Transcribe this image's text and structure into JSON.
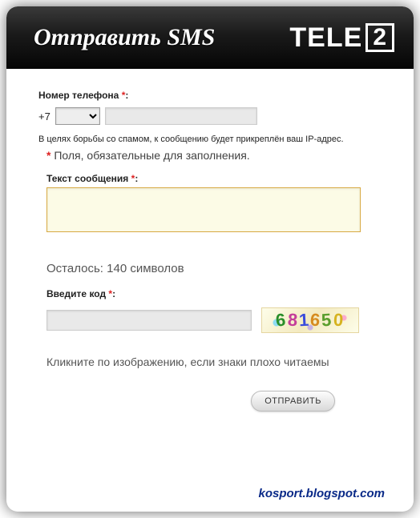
{
  "header": {
    "title": "Отправить SMS",
    "brand_text": "TELE",
    "brand_box": "2"
  },
  "phone": {
    "label": "Номер телефона",
    "prefix": "+7",
    "code_value": "",
    "number_value": ""
  },
  "notes": {
    "spam": "В целях борьбы со спамом, к сообщению будет прикреплён ваш IP-адрес.",
    "required": "Поля, обязательные для заполнения."
  },
  "message": {
    "label": "Текст сообщения",
    "value": "",
    "remaining_prefix": "Осталось:",
    "remaining_count": "140",
    "remaining_unit": "символов"
  },
  "captcha": {
    "label": "Введите код",
    "value": "",
    "digits": "681650",
    "hint": "Кликните по изображению, если знаки плохо читаемы"
  },
  "actions": {
    "submit": "ОТПРАВИТЬ"
  },
  "footer": {
    "link": "kosport.blogspot.com"
  }
}
